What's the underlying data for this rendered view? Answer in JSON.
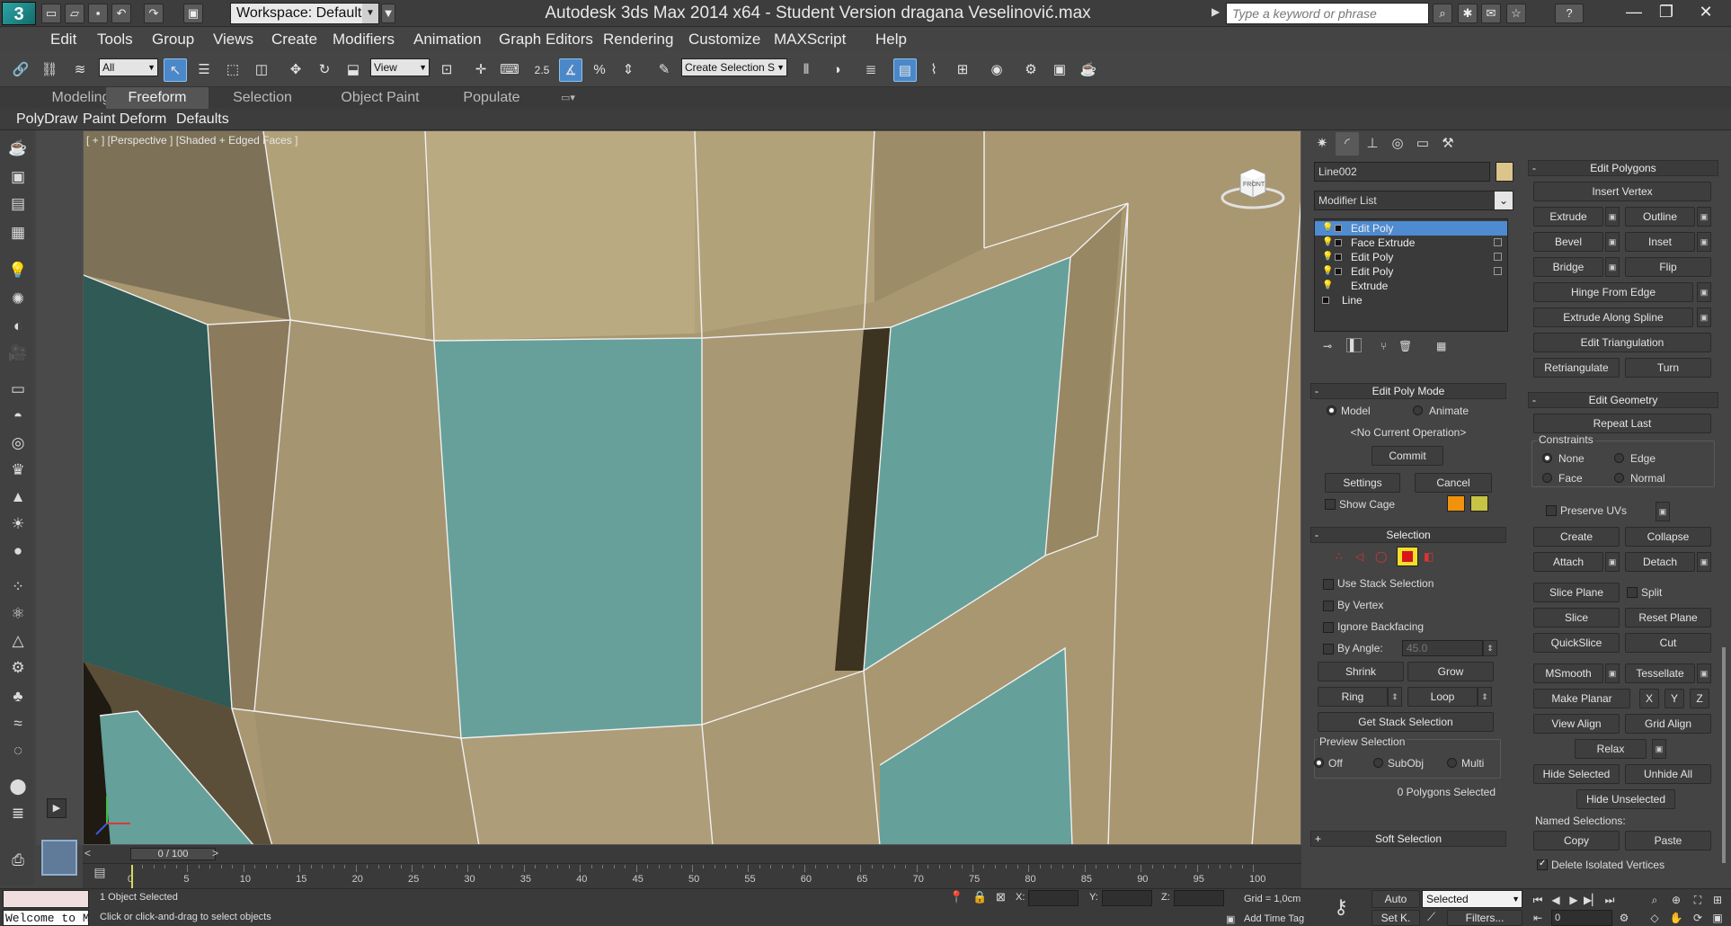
{
  "title": "Autodesk 3ds Max  2014 x64  - Student Version     dragana Veselinović.max",
  "workspace": "Workspace: Default",
  "search_placeholder": "Type a keyword or phrase",
  "menu": [
    "Edit",
    "Tools",
    "Group",
    "Views",
    "Create",
    "Modifiers",
    "Animation",
    "Graph Editors",
    "Rendering",
    "Customize",
    "MAXScript",
    "Help"
  ],
  "toolbar": {
    "selection_filter": "All",
    "ref_coord": "View",
    "snap_angle": "2.5",
    "named_selection": "Create Selection S"
  },
  "ribbon_tabs": [
    "Modeling",
    "Freeform",
    "Selection",
    "Object Paint",
    "Populate"
  ],
  "ribbon_sub": [
    "PolyDraw",
    "Paint Deform",
    "Defaults"
  ],
  "viewport_label": "[ + ] [Perspective ] [Shaded + Edged Faces ]",
  "viewcube_label": "FRONT",
  "object_name": "Line002",
  "object_color": "#dcc58a",
  "modifier_list_label": "Modifier List",
  "stack": [
    {
      "label": "Edit Poly",
      "selected": true
    },
    {
      "label": "Face Extrude",
      "selected": false
    },
    {
      "label": "Edit Poly",
      "selected": false
    },
    {
      "label": "Edit Poly",
      "selected": false
    },
    {
      "label": "Extrude",
      "selected": false
    },
    {
      "label": "Line",
      "selected": false
    }
  ],
  "edit_poly_mode": {
    "title": "Edit Poly Mode",
    "model": "Model",
    "animate": "Animate",
    "operation": "<No Current Operation>",
    "commit": "Commit",
    "settings": "Settings",
    "cancel": "Cancel",
    "show_cage": "Show Cage",
    "cage_colors": [
      "#f0920c",
      "#c8c443"
    ]
  },
  "selection": {
    "title": "Selection",
    "use_stack": "Use Stack Selection",
    "by_vertex": "By Vertex",
    "ignore_backfacing": "Ignore Backfacing",
    "by_angle": "By Angle:",
    "angle_value": "45.0",
    "shrink": "Shrink",
    "grow": "Grow",
    "ring": "Ring",
    "loop": "Loop",
    "get_stack": "Get Stack Selection",
    "preview_title": "Preview Selection",
    "off": "Off",
    "subobj": "SubObj",
    "multi": "Multi",
    "status": "0 Polygons Selected"
  },
  "soft_selection": "Soft Selection",
  "edit_polygons": {
    "title": "Edit Polygons",
    "insert_vertex": "Insert Vertex",
    "extrude": "Extrude",
    "outline": "Outline",
    "bevel": "Bevel",
    "inset": "Inset",
    "bridge": "Bridge",
    "flip": "Flip",
    "hinge": "Hinge From Edge",
    "extrude_spline": "Extrude Along Spline",
    "edit_tri": "Edit Triangulation",
    "retriangulate": "Retriangulate",
    "turn": "Turn"
  },
  "edit_geometry": {
    "title": "Edit Geometry",
    "repeat_last": "Repeat Last",
    "constraints": "Constraints",
    "none": "None",
    "edge": "Edge",
    "face": "Face",
    "normal": "Normal",
    "preserve_uvs": "Preserve UVs",
    "create": "Create",
    "collapse": "Collapse",
    "attach": "Attach",
    "detach": "Detach",
    "slice_plane": "Slice Plane",
    "split": "Split",
    "slice": "Slice",
    "reset_plane": "Reset Plane",
    "quickslice": "QuickSlice",
    "cut": "Cut",
    "msmooth": "MSmooth",
    "tessellate": "Tessellate",
    "make_planar": "Make Planar",
    "x": "X",
    "y": "Y",
    "z": "Z",
    "view_align": "View Align",
    "grid_align": "Grid Align",
    "relax": "Relax",
    "hide_selected": "Hide Selected",
    "unhide_all": "Unhide All",
    "hide_unselected": "Hide Unselected",
    "named_selections": "Named Selections:",
    "copy": "Copy",
    "paste": "Paste",
    "delete_isolated": "Delete Isolated Vertices"
  },
  "timeline": {
    "slider": "0 / 100",
    "ticks": [
      "0",
      "5",
      "10",
      "15",
      "20",
      "25",
      "30",
      "35",
      "40",
      "45",
      "50",
      "55",
      "60",
      "65",
      "70",
      "75",
      "80",
      "85",
      "90",
      "95",
      "100"
    ]
  },
  "status": {
    "welcome": "Welcome to MAXScript.",
    "objects": "1 Object Selected",
    "prompt": "Click or click-and-drag to select objects",
    "x_label": "X:",
    "y_label": "Y:",
    "z_label": "Z:",
    "grid": "Grid = 1,0cm",
    "add_time_tag": "Add Time Tag",
    "auto": "Auto",
    "selected": "Selected",
    "set_key": "Set K.",
    "filters": "Filters...",
    "frame": "0"
  }
}
